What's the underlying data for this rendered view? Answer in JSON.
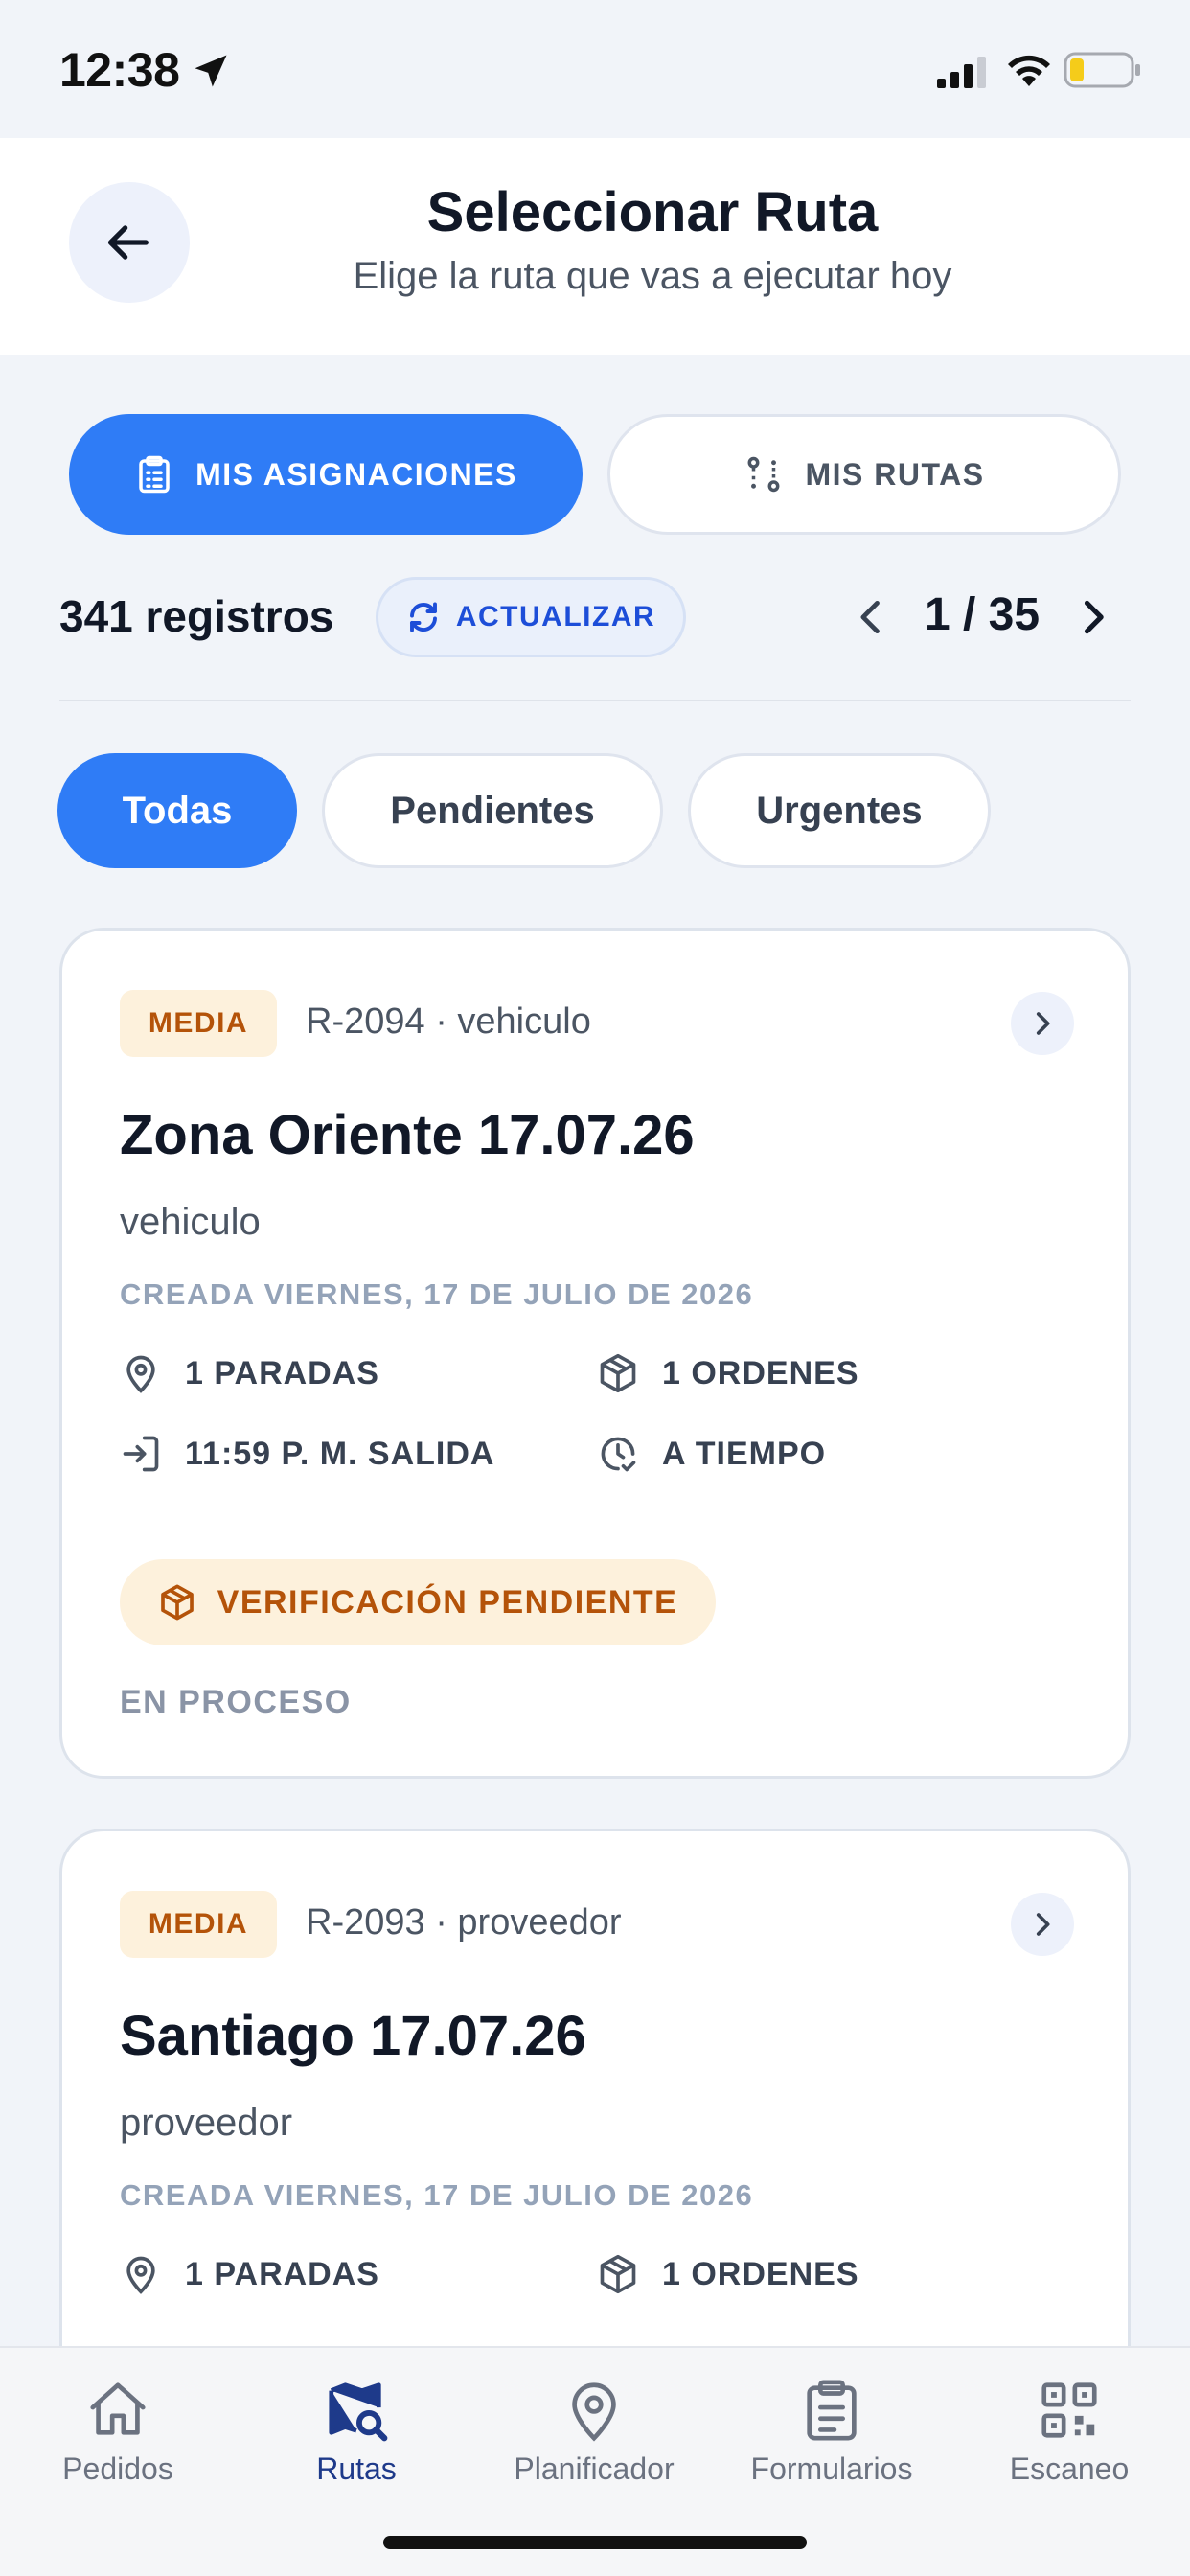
{
  "status_bar": {
    "time": "12:38"
  },
  "header": {
    "title": "Seleccionar Ruta",
    "subtitle": "Elige la ruta que vas a ejecutar hoy"
  },
  "segments": [
    {
      "label": "MIS ASIGNACIONES",
      "active": true,
      "icon": "clipboard-list-icon"
    },
    {
      "label": "MIS RUTAS",
      "active": false,
      "icon": "route-icon"
    }
  ],
  "records": {
    "count_label": "341 registros",
    "refresh_label": "ACTUALIZAR",
    "pager": "1 / 35"
  },
  "filters": [
    {
      "label": "Todas",
      "active": true
    },
    {
      "label": "Pendientes",
      "active": false
    },
    {
      "label": "Urgentes",
      "active": false
    }
  ],
  "routes": [
    {
      "priority": "MEDIA",
      "code": "R-2094 · vehiculo",
      "name": "Zona Oriente 17.07.26",
      "type": "vehiculo",
      "created": "CREADA VIERNES, 17 DE JULIO DE 2026",
      "stops": "1 PARADAS",
      "orders": "1 ORDENES",
      "departure": "11:59 P. M. SALIDA",
      "timing": "A TIEMPO",
      "verification": "VERIFICACIÓN PENDIENTE",
      "state": "EN PROCESO"
    },
    {
      "priority": "MEDIA",
      "code": "R-2093 · proveedor",
      "name": "Santiago 17.07.26",
      "type": "proveedor",
      "created": "CREADA VIERNES, 17 DE JULIO DE 2026",
      "stops": "1 PARADAS",
      "orders": "1 ORDENES"
    }
  ],
  "tab_bar": [
    {
      "label": "Pedidos",
      "icon": "home-icon",
      "active": false
    },
    {
      "label": "Rutas",
      "icon": "map-search-icon",
      "active": true
    },
    {
      "label": "Planificador",
      "icon": "map-pin-icon",
      "active": false
    },
    {
      "label": "Formularios",
      "icon": "clipboard-icon",
      "active": false
    },
    {
      "label": "Escaneo",
      "icon": "qr-code-icon",
      "active": false
    }
  ],
  "colors": {
    "primary": "#2f7cf6",
    "priority_bg": "#fdf1dc",
    "priority_text": "#b45309",
    "background": "#f1f4f9"
  }
}
